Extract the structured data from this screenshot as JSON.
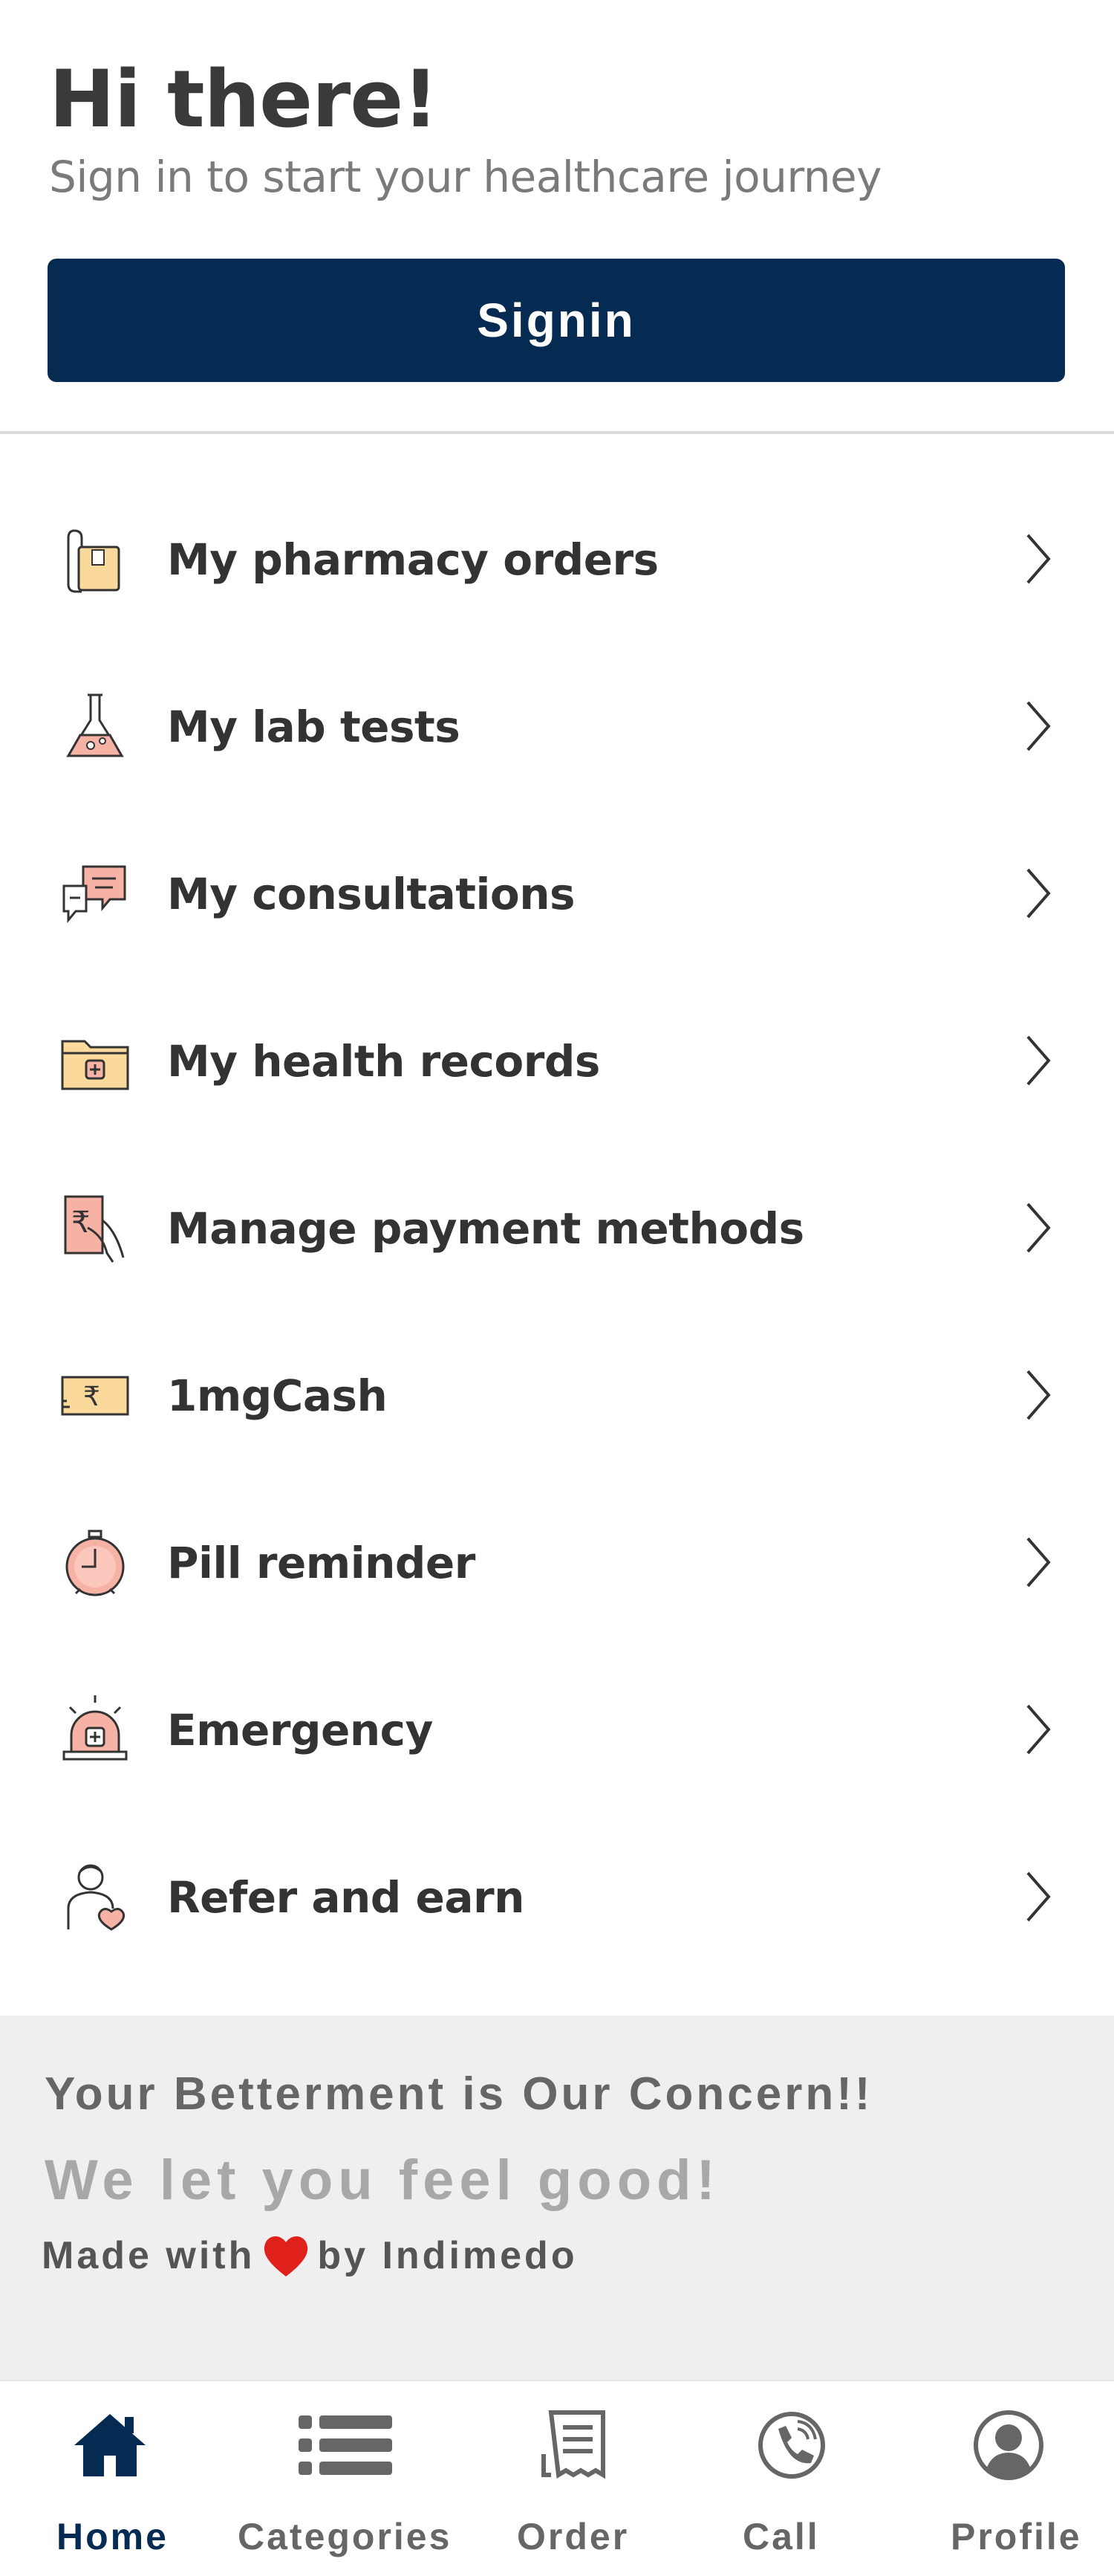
{
  "header": {
    "greeting": "Hi there!",
    "subtitle": "Sign in to start your healthcare journey",
    "signin_label": "Signin"
  },
  "menu": {
    "items": [
      {
        "label": "My pharmacy orders",
        "icon": "pharmacy-bag-icon"
      },
      {
        "label": "My lab tests",
        "icon": "lab-flask-icon"
      },
      {
        "label": "My consultations",
        "icon": "chat-bubbles-icon"
      },
      {
        "label": "My health records",
        "icon": "medical-folder-icon"
      },
      {
        "label": "Manage payment methods",
        "icon": "payment-hand-icon"
      },
      {
        "label": "1mgCash",
        "icon": "cash-note-icon"
      },
      {
        "label": "Pill reminder",
        "icon": "stopwatch-icon"
      },
      {
        "label": "Emergency",
        "icon": "siren-icon"
      },
      {
        "label": "Refer and earn",
        "icon": "doctor-heart-icon"
      }
    ]
  },
  "footer": {
    "tagline1": "Your Betterment is Our Concern!!",
    "tagline2": "We let you feel good!",
    "made_with": "Made with",
    "by": "by Indimedo"
  },
  "bottom_nav": {
    "items": [
      {
        "label": "Home",
        "icon": "home-icon",
        "active": true
      },
      {
        "label": "Categories",
        "icon": "list-icon",
        "active": false
      },
      {
        "label": "Order",
        "icon": "receipt-icon",
        "active": false
      },
      {
        "label": "Call",
        "icon": "phone-icon",
        "active": false
      },
      {
        "label": "Profile",
        "icon": "user-icon",
        "active": false
      }
    ]
  },
  "colors": {
    "primary": "#062b52",
    "icon_pink": "#f7b2a6",
    "icon_yellow": "#fbd99a",
    "footer_bg": "#efefef",
    "heart": "#e0201b"
  }
}
